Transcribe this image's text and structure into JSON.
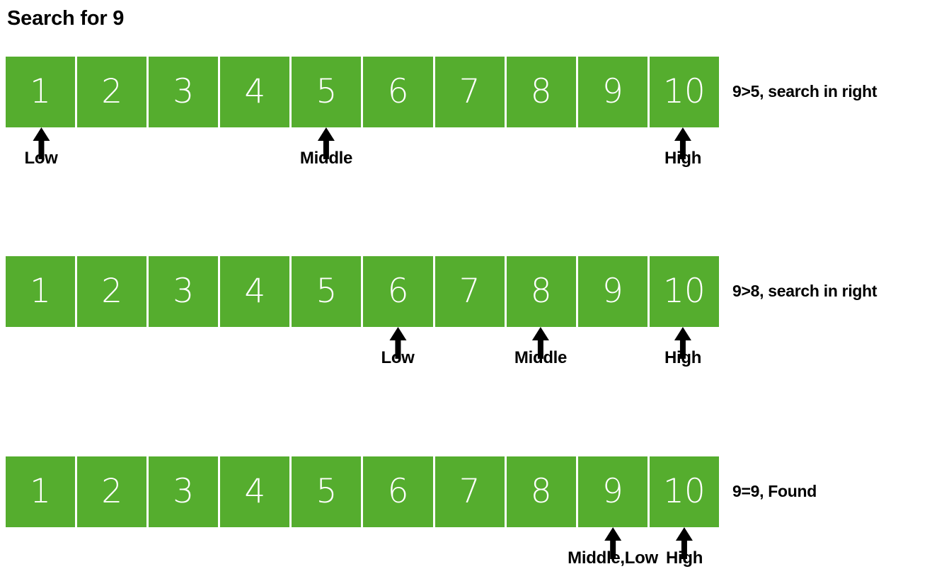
{
  "title": "Search for 9",
  "colors": {
    "cell_fill": "#55AD2E",
    "cell_text": "#ffffff",
    "label_text": "#000000",
    "background": "#ffffff"
  },
  "array_values": [
    "1",
    "2",
    "3",
    "4",
    "5",
    "6",
    "7",
    "8",
    "9",
    "10"
  ],
  "steps": [
    {
      "id": "step-1",
      "values": [
        "1",
        "2",
        "3",
        "4",
        "5",
        "6",
        "7",
        "8",
        "9",
        "10"
      ],
      "note": "9>5, search in right",
      "pointers": [
        {
          "label": "Low",
          "cell_index": 0
        },
        {
          "label": "Middle",
          "cell_index": 4
        },
        {
          "label": "High",
          "cell_index": 9
        }
      ]
    },
    {
      "id": "step-2",
      "values": [
        "1",
        "2",
        "3",
        "4",
        "5",
        "6",
        "7",
        "8",
        "9",
        "10"
      ],
      "note": "9>8, search in right",
      "pointers": [
        {
          "label": "Low",
          "cell_index": 5
        },
        {
          "label": "Middle",
          "cell_index": 7
        },
        {
          "label": "High",
          "cell_index": 9
        }
      ]
    },
    {
      "id": "step-3",
      "values": [
        "1",
        "2",
        "3",
        "4",
        "5",
        "6",
        "7",
        "8",
        "9",
        "10"
      ],
      "note": "9=9, Found",
      "pointers": [
        {
          "label": "Middle,Low",
          "cell_index": 8
        },
        {
          "label": "High",
          "cell_index": 9
        }
      ]
    }
  ]
}
